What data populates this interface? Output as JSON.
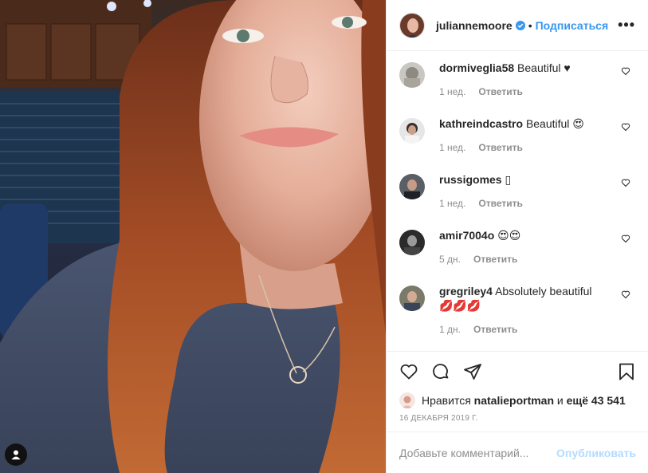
{
  "post": {
    "author": "juliannemoore",
    "verified": true,
    "separator": "•",
    "follow_label": "Подписаться",
    "more_label": "•••"
  },
  "comments": [
    {
      "user": "dormiveglia58",
      "text": "Beautiful ♥",
      "age": "1 нед.",
      "reply": "Ответить"
    },
    {
      "user": "kathreindcastro",
      "text": "Beautiful 😍",
      "age": "1 нед.",
      "reply": "Ответить"
    },
    {
      "user": "russigomes",
      "text": "▯",
      "age": "1 нед.",
      "reply": "Ответить"
    },
    {
      "user": "amir7004o",
      "text": "😍😍",
      "age": "5 дн.",
      "reply": "Ответить"
    },
    {
      "user": "gregriley4",
      "text": "Absolutely beautiful 💋💋💋",
      "age": "1 дн.",
      "reply": "Ответить"
    }
  ],
  "likes": {
    "prefix": "Нравится",
    "user": "natalieportman",
    "conj": "и",
    "rest": "ещё 43 541"
  },
  "date": "16 ДЕКАБРЯ 2019 Г.",
  "add_comment": {
    "placeholder": "Добавьте комментарий...",
    "publish_label": "Опубликовать"
  },
  "colors": {
    "link": "#3897f0",
    "publish_disabled": "#b3dbff",
    "meta": "#8e8e8e"
  }
}
